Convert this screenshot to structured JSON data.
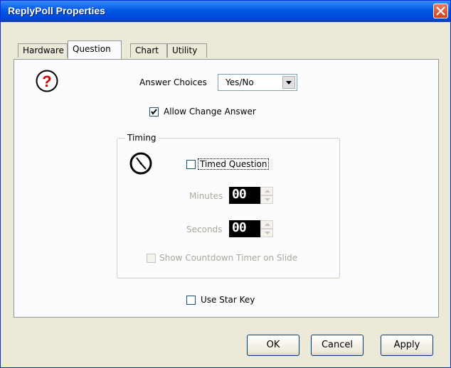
{
  "window": {
    "title": "ReplyPoll Properties"
  },
  "tabs": [
    {
      "label": "Hardware"
    },
    {
      "label": "Question"
    },
    {
      "label": "Chart"
    },
    {
      "label": "Utility"
    }
  ],
  "question": {
    "answer_choices_label": "Answer Choices",
    "answer_choices_value": "Yes/No",
    "allow_change_label": "Allow Change Answer",
    "allow_change_checked": true,
    "timing": {
      "legend": "Timing",
      "timed_question_label": "Timed Question",
      "timed_question_checked": false,
      "minutes_label": "Minutes",
      "minutes_value": "00",
      "seconds_label": "Seconds",
      "seconds_value": "00",
      "show_countdown_label": "Show Countdown Timer on Slide",
      "show_countdown_checked": false
    },
    "use_star_key_label": "Use Star Key",
    "use_star_key_checked": false
  },
  "buttons": {
    "ok": "OK",
    "cancel": "Cancel",
    "apply": "Apply"
  },
  "icons": {
    "question": "question-mark-icon",
    "clock": "clock-icon",
    "close": "close-icon"
  },
  "colors": {
    "titlebar": "#0058e6",
    "close": "#d4421e",
    "dialog": "#ece9d8",
    "panel": "#fcfcfe"
  }
}
